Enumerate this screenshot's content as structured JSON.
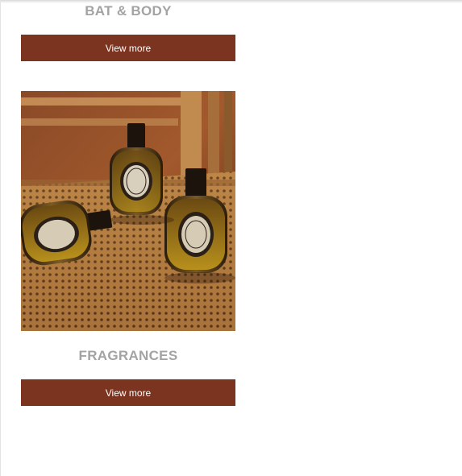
{
  "sections": [
    {
      "title": "BAT & BODY",
      "button_label": "View more"
    },
    {
      "title": "FRAGRANCES",
      "button_label": "View more",
      "image_alt": "fragrances-product-photo"
    }
  ],
  "colors": {
    "button_bg": "#7a341f",
    "button_text": "#ffffff",
    "title_text": "#a3a3a3"
  }
}
